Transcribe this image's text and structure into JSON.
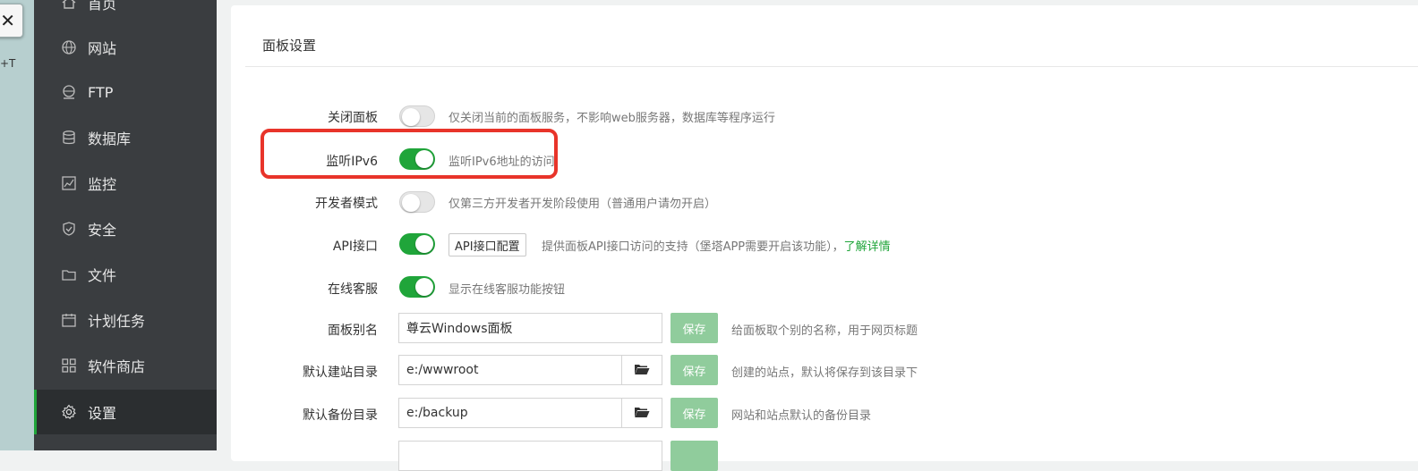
{
  "window": {
    "close_glyph": "✕",
    "side_text": "+T"
  },
  "sidebar": {
    "items": [
      {
        "label": "首页",
        "icon": "home-icon"
      },
      {
        "label": "网站",
        "icon": "globe-icon"
      },
      {
        "label": "FTP",
        "icon": "ftp-globe-icon"
      },
      {
        "label": "数据库",
        "icon": "database-icon"
      },
      {
        "label": "监控",
        "icon": "monitor-icon"
      },
      {
        "label": "安全",
        "icon": "shield-icon"
      },
      {
        "label": "文件",
        "icon": "folder-icon"
      },
      {
        "label": "计划任务",
        "icon": "calendar-icon"
      },
      {
        "label": "软件商店",
        "icon": "grid-icon"
      },
      {
        "label": "设置",
        "icon": "gear-icon",
        "active": true
      }
    ]
  },
  "panel": {
    "title": "面板设置",
    "settings": {
      "close_panel": {
        "label": "关闭面板",
        "on": false,
        "desc": "仅关闭当前的面板服务，不影响web服务器，数据库等程序运行"
      },
      "ipv6": {
        "label": "监听IPv6",
        "on": true,
        "desc": "监听IPv6地址的访问"
      },
      "dev_mode": {
        "label": "开发者模式",
        "on": false,
        "desc": "仅第三方开发者开发阶段使用（普通用户请勿开启）"
      },
      "api": {
        "label": "API接口",
        "on": true,
        "button": "API接口配置",
        "desc": "提供面板API接口访问的支持（堡塔APP需要开启该功能），",
        "link": "了解详情"
      },
      "online_service": {
        "label": "在线客服",
        "on": true,
        "desc": "显示在线客服功能按钮"
      },
      "panel_alias": {
        "label": "面板别名",
        "value": "尊云Windows面板",
        "save": "保存",
        "desc": "给面板取个别的名称，用于网页标题"
      },
      "site_dir": {
        "label": "默认建站目录",
        "value": "e:/wwwroot",
        "save": "保存",
        "desc": "创建的站点，默认将保存到该目录下"
      },
      "backup_dir": {
        "label": "默认备份目录",
        "value": "e:/backup",
        "save": "保存",
        "desc": "网站和站点默认的备份目录"
      }
    }
  },
  "colors": {
    "accent": "#20a53a",
    "highlight": "#e8342a",
    "sidebar_bg": "#3a3d40"
  }
}
